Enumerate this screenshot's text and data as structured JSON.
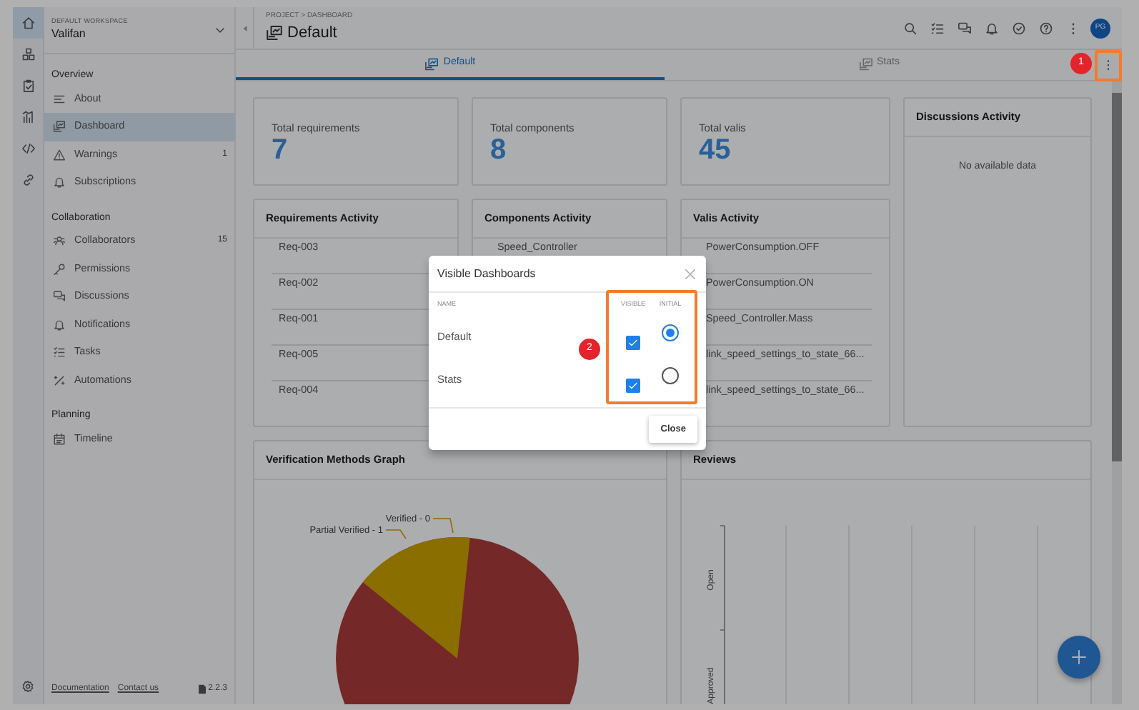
{
  "rail": {
    "items": [
      {
        "selected": true
      },
      {
        "selected": false
      },
      {
        "selected": false
      },
      {
        "selected": false
      },
      {
        "selected": false
      },
      {
        "selected": false
      }
    ]
  },
  "sidebar": {
    "workspace_label": "DEFAULT WORKSPACE",
    "workspace_name": "Valifan",
    "sections": [
      {
        "title": "Overview",
        "items": [
          {
            "label": "About",
            "selected": false
          },
          {
            "label": "Dashboard",
            "selected": true
          },
          {
            "label": "Warnings",
            "count": "1",
            "selected": false
          },
          {
            "label": "Subscriptions",
            "selected": false
          }
        ]
      },
      {
        "title": "Collaboration",
        "items": [
          {
            "label": "Collaborators",
            "count": "15",
            "selected": false
          },
          {
            "label": "Permissions",
            "selected": false
          },
          {
            "label": "Discussions",
            "selected": false
          },
          {
            "label": "Notifications",
            "selected": false
          },
          {
            "label": "Tasks",
            "selected": false
          },
          {
            "label": "Automations",
            "selected": false
          }
        ]
      },
      {
        "title": "Planning",
        "items": [
          {
            "label": "Timeline",
            "selected": false
          }
        ]
      }
    ],
    "footer_links": [
      "Documentation",
      "Contact us"
    ],
    "version": "2.2.3"
  },
  "header": {
    "breadcrumb": "PROJECT > DASHBOARD",
    "title": "Default",
    "avatar": "PG"
  },
  "tabs": [
    {
      "label": "Default",
      "selected": true
    },
    {
      "label": "Stats",
      "selected": false
    }
  ],
  "stats": [
    {
      "label": "Total requirements",
      "value": "7"
    },
    {
      "label": "Total components",
      "value": "8"
    },
    {
      "label": "Total valis",
      "value": "45"
    }
  ],
  "discussions": {
    "title": "Discussions Activity",
    "empty_text": "No available data"
  },
  "activities": [
    {
      "title": "Requirements Activity",
      "items": [
        "Req-003",
        "Req-002",
        "Req-001",
        "Req-005",
        "Req-004"
      ]
    },
    {
      "title": "Components Activity",
      "items": [
        "Speed_Controller"
      ]
    },
    {
      "title": "Valis Activity",
      "items": [
        "PowerConsumption.OFF",
        "PowerConsumption.ON",
        "Speed_Controller.Mass",
        "link_speed_settings_to_state_66...",
        "link_speed_settings_to_state_66..."
      ]
    }
  ],
  "verification": {
    "title": "Verification Methods Graph",
    "slice_labels": [
      "Verified - 0",
      "Partial Verified - 1"
    ]
  },
  "reviews": {
    "title": "Reviews",
    "axis_labels": [
      "Open",
      "Approved"
    ]
  },
  "modal": {
    "title": "Visible Dashboards",
    "columns": [
      "NAME",
      "VISIBLE",
      "INITIAL"
    ],
    "rows": [
      {
        "name": "Default",
        "visible": true,
        "initial": true
      },
      {
        "name": "Stats",
        "visible": true,
        "initial": false
      }
    ],
    "close_label": "Close"
  },
  "annotations": [
    "1",
    "2"
  ]
}
